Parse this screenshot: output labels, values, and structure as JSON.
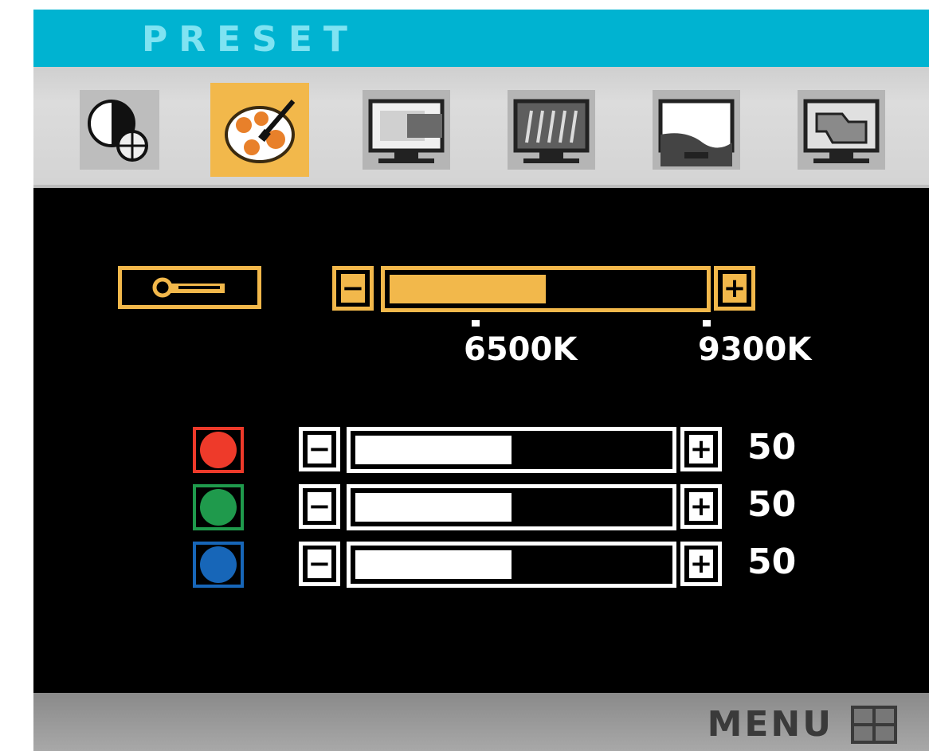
{
  "header": {
    "title": "PRESET"
  },
  "tabs": [
    {
      "icon": "brightness-contrast-icon",
      "active": false
    },
    {
      "icon": "color-palette-icon",
      "active": true
    },
    {
      "icon": "monitor-position-icon",
      "active": false
    },
    {
      "icon": "monitor-tracking-icon",
      "active": false
    },
    {
      "icon": "monitor-setup-icon",
      "active": false
    },
    {
      "icon": "monitor-special-icon",
      "active": false
    }
  ],
  "color_temp": {
    "minus_label": "−",
    "plus_label": "+",
    "level_fraction": 0.5,
    "ticks": [
      "6500K",
      "9300K"
    ]
  },
  "rgb": [
    {
      "name": "red",
      "color": "#ee3a2a",
      "minus_label": "−",
      "plus_label": "+",
      "value": "50",
      "level_fraction": 0.5
    },
    {
      "name": "green",
      "color": "#1f9a4c",
      "minus_label": "−",
      "plus_label": "+",
      "value": "50",
      "level_fraction": 0.5
    },
    {
      "name": "blue",
      "color": "#1766b8",
      "minus_label": "−",
      "plus_label": "+",
      "value": "50",
      "level_fraction": 0.5
    }
  ],
  "footer": {
    "menu_label": "MENU"
  },
  "colors": {
    "title_bar": "#00b3d1",
    "accent": "#f2b84b",
    "panel": "#000000"
  }
}
